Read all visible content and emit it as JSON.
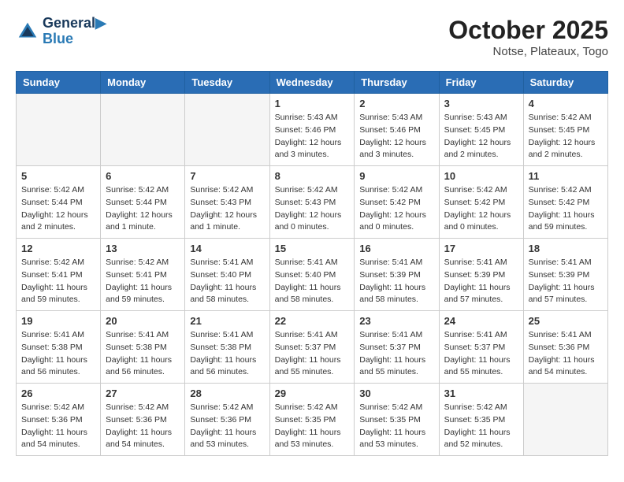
{
  "header": {
    "logo_line1": "General",
    "logo_line2": "Blue",
    "title": "October 2025",
    "subtitle": "Notse, Plateaux, Togo"
  },
  "days_of_week": [
    "Sunday",
    "Monday",
    "Tuesday",
    "Wednesday",
    "Thursday",
    "Friday",
    "Saturday"
  ],
  "weeks": [
    [
      {
        "day": "",
        "info": ""
      },
      {
        "day": "",
        "info": ""
      },
      {
        "day": "",
        "info": ""
      },
      {
        "day": "1",
        "info": "Sunrise: 5:43 AM\nSunset: 5:46 PM\nDaylight: 12 hours\nand 3 minutes."
      },
      {
        "day": "2",
        "info": "Sunrise: 5:43 AM\nSunset: 5:46 PM\nDaylight: 12 hours\nand 3 minutes."
      },
      {
        "day": "3",
        "info": "Sunrise: 5:43 AM\nSunset: 5:45 PM\nDaylight: 12 hours\nand 2 minutes."
      },
      {
        "day": "4",
        "info": "Sunrise: 5:42 AM\nSunset: 5:45 PM\nDaylight: 12 hours\nand 2 minutes."
      }
    ],
    [
      {
        "day": "5",
        "info": "Sunrise: 5:42 AM\nSunset: 5:44 PM\nDaylight: 12 hours\nand 2 minutes."
      },
      {
        "day": "6",
        "info": "Sunrise: 5:42 AM\nSunset: 5:44 PM\nDaylight: 12 hours\nand 1 minute."
      },
      {
        "day": "7",
        "info": "Sunrise: 5:42 AM\nSunset: 5:43 PM\nDaylight: 12 hours\nand 1 minute."
      },
      {
        "day": "8",
        "info": "Sunrise: 5:42 AM\nSunset: 5:43 PM\nDaylight: 12 hours\nand 0 minutes."
      },
      {
        "day": "9",
        "info": "Sunrise: 5:42 AM\nSunset: 5:42 PM\nDaylight: 12 hours\nand 0 minutes."
      },
      {
        "day": "10",
        "info": "Sunrise: 5:42 AM\nSunset: 5:42 PM\nDaylight: 12 hours\nand 0 minutes."
      },
      {
        "day": "11",
        "info": "Sunrise: 5:42 AM\nSunset: 5:42 PM\nDaylight: 11 hours\nand 59 minutes."
      }
    ],
    [
      {
        "day": "12",
        "info": "Sunrise: 5:42 AM\nSunset: 5:41 PM\nDaylight: 11 hours\nand 59 minutes."
      },
      {
        "day": "13",
        "info": "Sunrise: 5:42 AM\nSunset: 5:41 PM\nDaylight: 11 hours\nand 59 minutes."
      },
      {
        "day": "14",
        "info": "Sunrise: 5:41 AM\nSunset: 5:40 PM\nDaylight: 11 hours\nand 58 minutes."
      },
      {
        "day": "15",
        "info": "Sunrise: 5:41 AM\nSunset: 5:40 PM\nDaylight: 11 hours\nand 58 minutes."
      },
      {
        "day": "16",
        "info": "Sunrise: 5:41 AM\nSunset: 5:39 PM\nDaylight: 11 hours\nand 58 minutes."
      },
      {
        "day": "17",
        "info": "Sunrise: 5:41 AM\nSunset: 5:39 PM\nDaylight: 11 hours\nand 57 minutes."
      },
      {
        "day": "18",
        "info": "Sunrise: 5:41 AM\nSunset: 5:39 PM\nDaylight: 11 hours\nand 57 minutes."
      }
    ],
    [
      {
        "day": "19",
        "info": "Sunrise: 5:41 AM\nSunset: 5:38 PM\nDaylight: 11 hours\nand 56 minutes."
      },
      {
        "day": "20",
        "info": "Sunrise: 5:41 AM\nSunset: 5:38 PM\nDaylight: 11 hours\nand 56 minutes."
      },
      {
        "day": "21",
        "info": "Sunrise: 5:41 AM\nSunset: 5:38 PM\nDaylight: 11 hours\nand 56 minutes."
      },
      {
        "day": "22",
        "info": "Sunrise: 5:41 AM\nSunset: 5:37 PM\nDaylight: 11 hours\nand 55 minutes."
      },
      {
        "day": "23",
        "info": "Sunrise: 5:41 AM\nSunset: 5:37 PM\nDaylight: 11 hours\nand 55 minutes."
      },
      {
        "day": "24",
        "info": "Sunrise: 5:41 AM\nSunset: 5:37 PM\nDaylight: 11 hours\nand 55 minutes."
      },
      {
        "day": "25",
        "info": "Sunrise: 5:41 AM\nSunset: 5:36 PM\nDaylight: 11 hours\nand 54 minutes."
      }
    ],
    [
      {
        "day": "26",
        "info": "Sunrise: 5:42 AM\nSunset: 5:36 PM\nDaylight: 11 hours\nand 54 minutes."
      },
      {
        "day": "27",
        "info": "Sunrise: 5:42 AM\nSunset: 5:36 PM\nDaylight: 11 hours\nand 54 minutes."
      },
      {
        "day": "28",
        "info": "Sunrise: 5:42 AM\nSunset: 5:36 PM\nDaylight: 11 hours\nand 53 minutes."
      },
      {
        "day": "29",
        "info": "Sunrise: 5:42 AM\nSunset: 5:35 PM\nDaylight: 11 hours\nand 53 minutes."
      },
      {
        "day": "30",
        "info": "Sunrise: 5:42 AM\nSunset: 5:35 PM\nDaylight: 11 hours\nand 53 minutes."
      },
      {
        "day": "31",
        "info": "Sunrise: 5:42 AM\nSunset: 5:35 PM\nDaylight: 11 hours\nand 52 minutes."
      },
      {
        "day": "",
        "info": ""
      }
    ]
  ]
}
